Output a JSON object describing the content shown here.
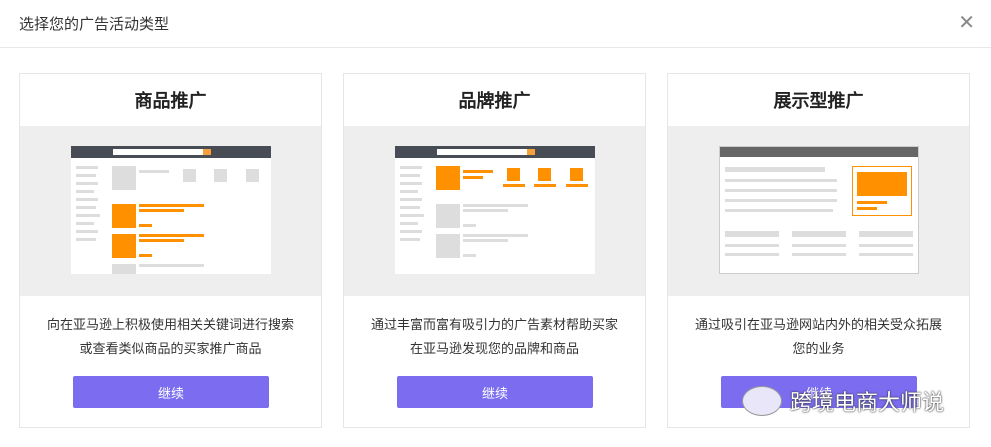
{
  "dialog": {
    "title": "选择您的广告活动类型",
    "close_icon": "close-icon"
  },
  "cards": [
    {
      "title": "商品推广",
      "description": "向在亚马逊上积极使用相关关键词进行搜索或查看类似商品的买家推广商品",
      "button": "继续"
    },
    {
      "title": "品牌推广",
      "description": "通过丰富而富有吸引力的广告素材帮助买家在亚马逊发现您的品牌和商品",
      "button": "继续"
    },
    {
      "title": "展示型推广",
      "description": "通过吸引在亚马逊网站内外的相关受众拓展您的业务",
      "button": "继续"
    }
  ],
  "watermark": "跨境电商大师说",
  "colors": {
    "button": "#7b6cf0",
    "accent": "#ff9100"
  }
}
